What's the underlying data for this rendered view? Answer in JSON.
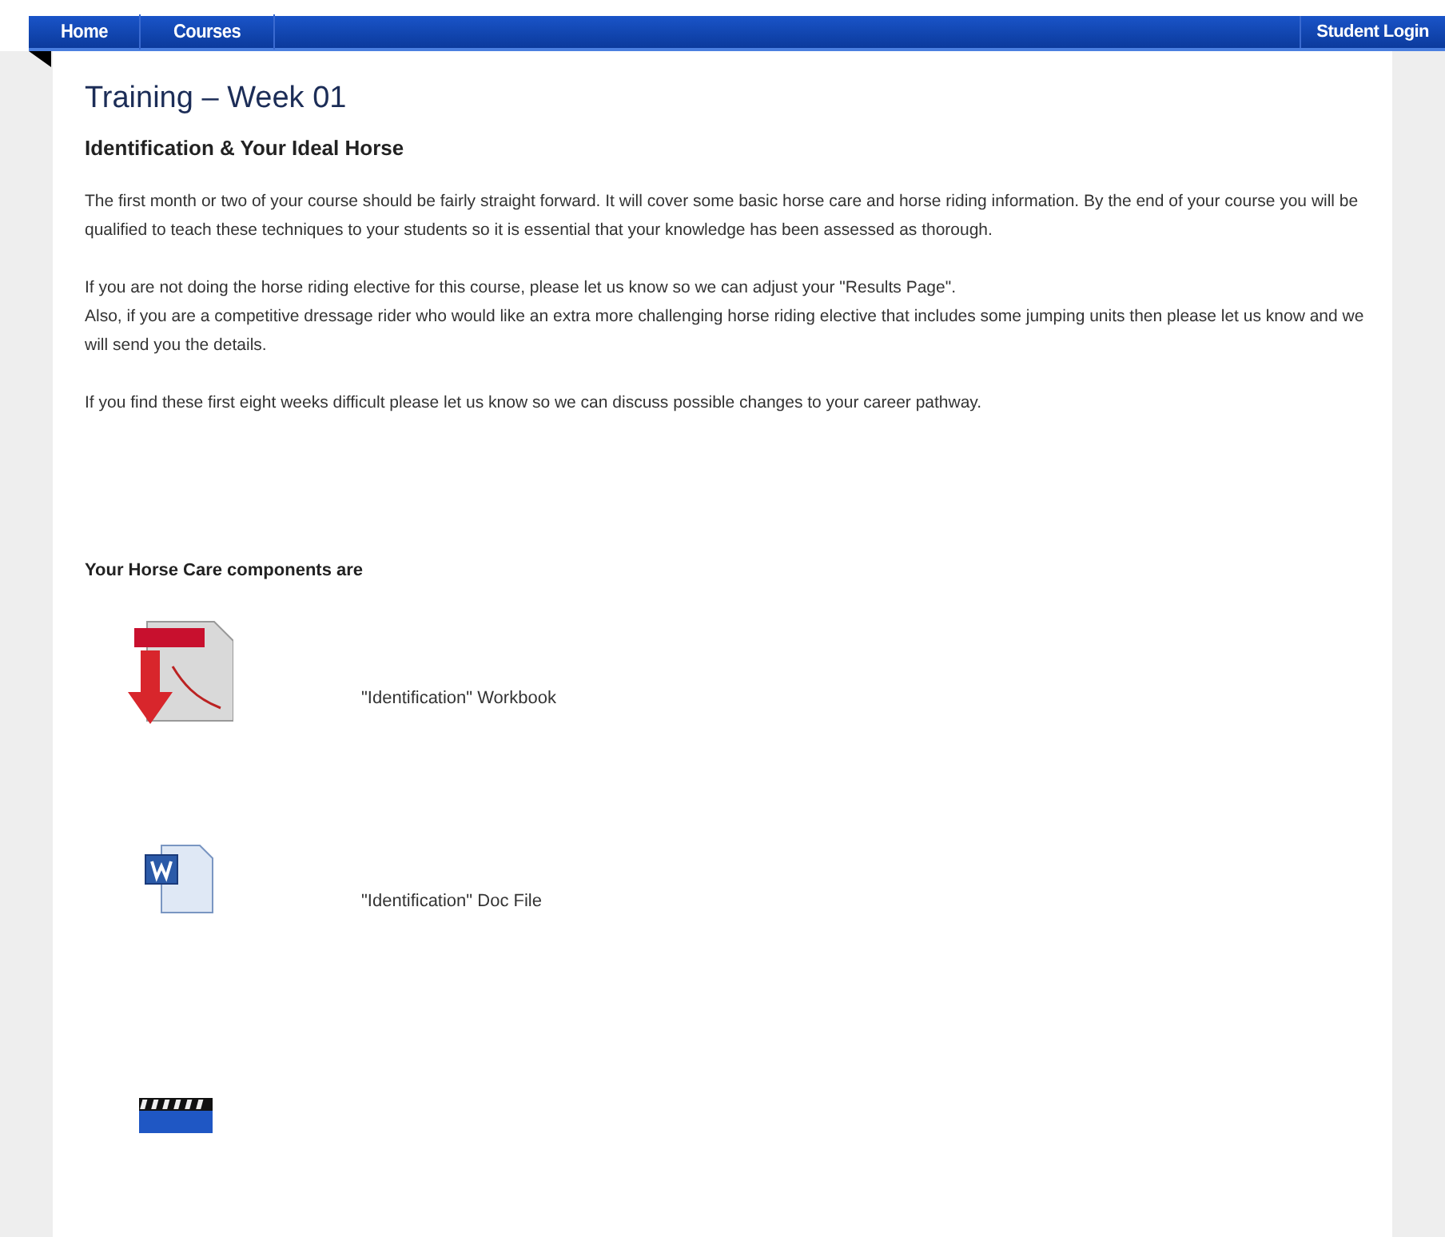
{
  "nav": {
    "left": [
      {
        "label": "Home"
      },
      {
        "label": "Courses"
      }
    ],
    "right": [
      {
        "label": "Student Login"
      }
    ]
  },
  "title": "Training – Week 01",
  "subtitle": "Identification & Your Ideal Horse",
  "paragraphs": [
    {
      "lines": [
        "The first month or two of your course should be fairly straight forward. It will cover some basic horse care and horse riding information. By the end of your course you will be qualified to teach these techniques to your students so it is essential that your knowledge has been assessed as thorough."
      ]
    },
    {
      "lines": [
        "If you are not doing the horse riding elective for this course, please let us know so we can adjust your \"Results Page\".",
        "Also, if you are a competitive dressage rider who would like an extra more challenging horse riding elective that includes some jumping units then please let us know and we will send you the details."
      ]
    },
    {
      "lines": [
        "If you find these first eight weeks difficult please let us know so we can discuss possible changes to your career pathway."
      ]
    }
  ],
  "components_heading": "Your Horse Care components are",
  "components": [
    {
      "kind": "pdf",
      "label": "\"Identification\" Workbook"
    },
    {
      "kind": "doc",
      "label": "\"Identification\" Doc File"
    },
    {
      "kind": "video"
    }
  ]
}
